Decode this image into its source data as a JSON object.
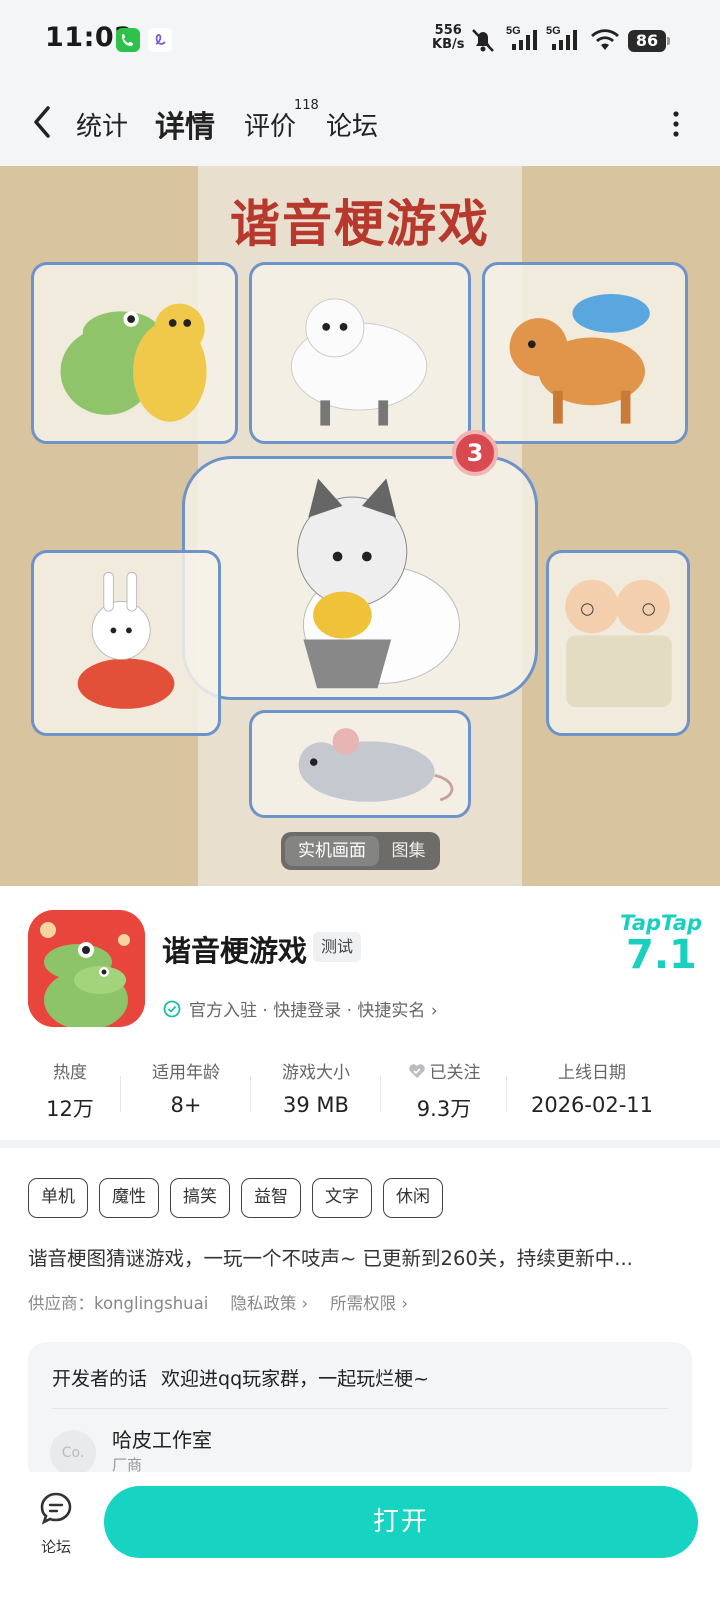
{
  "status_bar": {
    "time": "11:02",
    "net_speed_value": "556",
    "net_speed_unit": "KB/s",
    "battery": "86"
  },
  "header": {
    "tabs": [
      {
        "label": "统计"
      },
      {
        "label": "详情"
      },
      {
        "label": "评价"
      },
      {
        "label": "论坛"
      }
    ],
    "review_count": "118"
  },
  "hero": {
    "title": "谐音梗游戏",
    "badge": "3",
    "toggle_selected": "实机画面",
    "toggle_other": "图集"
  },
  "app": {
    "name": "谐音梗游戏",
    "tag": "测试",
    "platform_logo": "TapTap",
    "score": "7.1",
    "official_text": "官方入驻 · 快捷登录 · 快捷实名 ›"
  },
  "stats": [
    {
      "label": "热度",
      "value": "12万"
    },
    {
      "label": "适用年龄",
      "value": "8+"
    },
    {
      "label": "游戏大小",
      "value": "39 MB"
    },
    {
      "label": "已关注",
      "value": "9.3万"
    },
    {
      "label": "上线日期",
      "value": "2026-02-11"
    }
  ],
  "tags": [
    "单机",
    "魔性",
    "搞笑",
    "益智",
    "文字",
    "休闲"
  ],
  "description": "谐音梗图猜谜游戏，一玩一个不吱声~ 已更新到260关，持续更新中...",
  "meta": {
    "supplier": "供应商：konglingshuai",
    "privacy": "隐私政策",
    "permissions": "所需权限"
  },
  "developer": {
    "words_label": "开发者的话",
    "words_text": "欢迎进qq玩家群，一起玩烂梗~",
    "avatar_text": "Co.",
    "name": "哈皮工作室",
    "role": "厂商"
  },
  "bottom": {
    "forum_label": "论坛",
    "open_label": "打开"
  },
  "colors": {
    "accent": "#16d3c2",
    "hero_bg": "#d8c49f",
    "title_red": "#b7382c"
  }
}
